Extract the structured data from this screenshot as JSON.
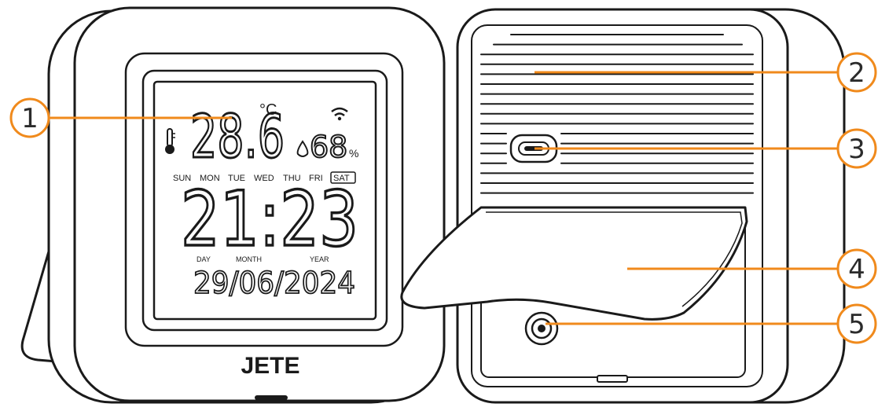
{
  "brand": "JETE",
  "display": {
    "temperature": "28.6",
    "temp_unit": "°C",
    "humidity": "68",
    "humidity_unit": "%",
    "weekdays": [
      "SUN",
      "MON",
      "TUE",
      "WED",
      "THU",
      "FRI",
      "SAT"
    ],
    "active_weekday": "SAT",
    "time": "21:23",
    "date_labels": {
      "day": "DAY",
      "month": "MONTH",
      "year": "YEAR"
    },
    "date": "29/06/2024"
  },
  "callouts": [
    "1",
    "2",
    "3",
    "4",
    "5"
  ],
  "colors": {
    "callout": "#f08a1c",
    "outline": "#1a1a1a",
    "housing": "#ffffff"
  },
  "icons": [
    "wifi-icon",
    "thermometer-icon",
    "humidity-drop-icon"
  ]
}
